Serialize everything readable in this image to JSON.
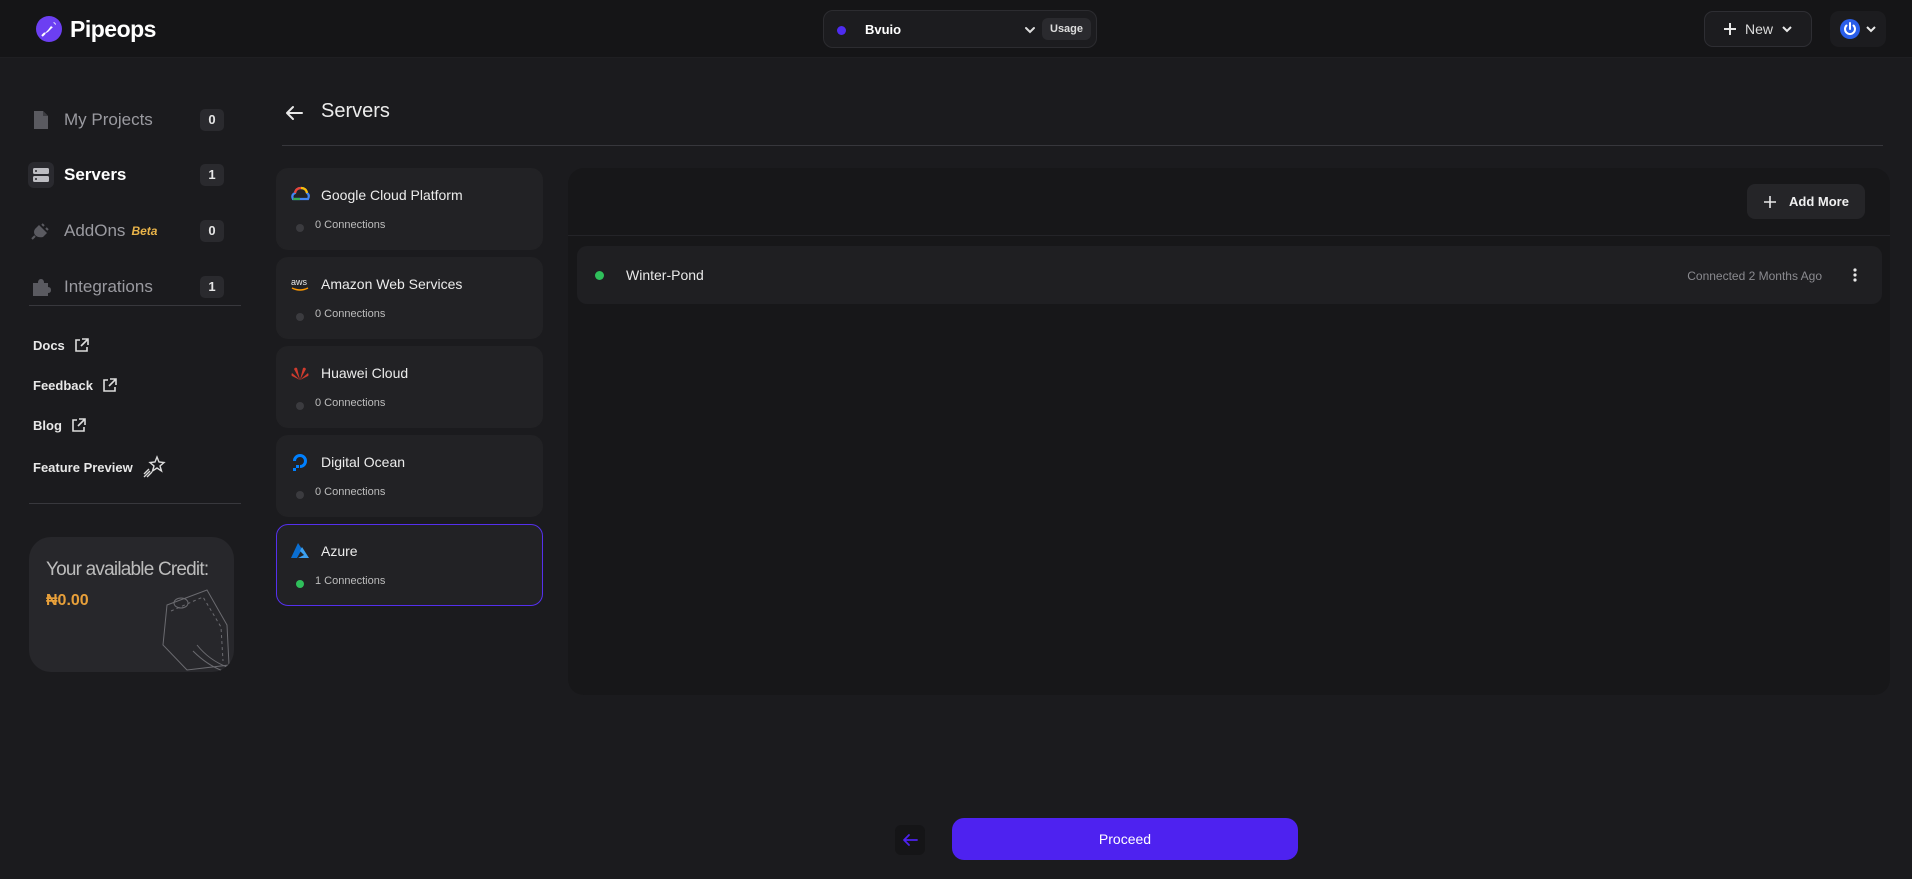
{
  "app": {
    "name": "Pipeops"
  },
  "workspace": {
    "name": "Bvuio",
    "usage_label": "Usage"
  },
  "topbar": {
    "new_label": "New"
  },
  "sidebar": {
    "items": [
      {
        "label": "My Projects",
        "count": "0",
        "icon": "file-icon"
      },
      {
        "label": "Servers",
        "count": "1",
        "icon": "server-icon"
      },
      {
        "label": "AddOns",
        "badge": "Beta",
        "count": "0",
        "icon": "plug-icon"
      },
      {
        "label": "Integrations",
        "count": "1",
        "icon": "puzzle-icon"
      }
    ],
    "links": [
      {
        "label": "Docs",
        "icon": "external-link-icon"
      },
      {
        "label": "Feedback",
        "icon": "external-link-icon"
      },
      {
        "label": "Blog",
        "icon": "external-link-icon"
      },
      {
        "label": "Feature Preview",
        "icon": "shooting-star-icon"
      }
    ],
    "credit": {
      "title": "Your available Credit:",
      "value": "₦0.00"
    }
  },
  "main": {
    "title": "Servers",
    "providers": [
      {
        "name": "Google Cloud Platform",
        "connections": "0 Connections",
        "icon": "gcp-icon"
      },
      {
        "name": "Amazon Web Services",
        "connections": "0 Connections",
        "icon": "aws-icon"
      },
      {
        "name": "Huawei Cloud",
        "connections": "0 Connections",
        "icon": "huawei-icon"
      },
      {
        "name": "Digital Ocean",
        "connections": "0 Connections",
        "icon": "digitalocean-icon"
      },
      {
        "name": "Azure",
        "connections": "1 Connections",
        "icon": "azure-icon",
        "selected": true
      }
    ],
    "panel": {
      "add_more_label": "Add More",
      "servers": [
        {
          "name": "Winter-Pond",
          "status": "Connected 2 Months Ago",
          "online": true
        }
      ]
    }
  },
  "footer": {
    "proceed_label": "Proceed"
  },
  "colors": {
    "accent": "#4e22f0",
    "online": "#2fbf5b",
    "credit": "#e8a03a",
    "beta": "#e9b44a"
  }
}
